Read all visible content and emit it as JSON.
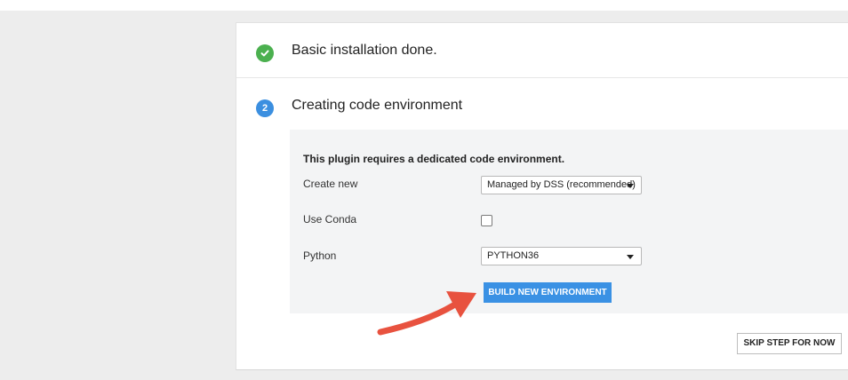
{
  "steps": [
    {
      "status": "done",
      "title": "Basic installation done.",
      "icon": "check-icon"
    },
    {
      "status": "active",
      "number": "2",
      "title": "Creating code environment"
    }
  ],
  "panel": {
    "heading": "This plugin requires a dedicated code environment.",
    "create_new": {
      "label": "Create new",
      "value": "Managed by DSS (recommended)"
    },
    "use_conda": {
      "label": "Use Conda",
      "checked": false
    },
    "python": {
      "label": "Python",
      "value": "PYTHON36"
    },
    "build_button": "BUILD NEW ENVIRONMENT"
  },
  "skip_button": "SKIP STEP FOR NOW",
  "colors": {
    "success": "#4bb04f",
    "accent": "#3a91e4",
    "annotation_arrow": "#e8523f"
  }
}
